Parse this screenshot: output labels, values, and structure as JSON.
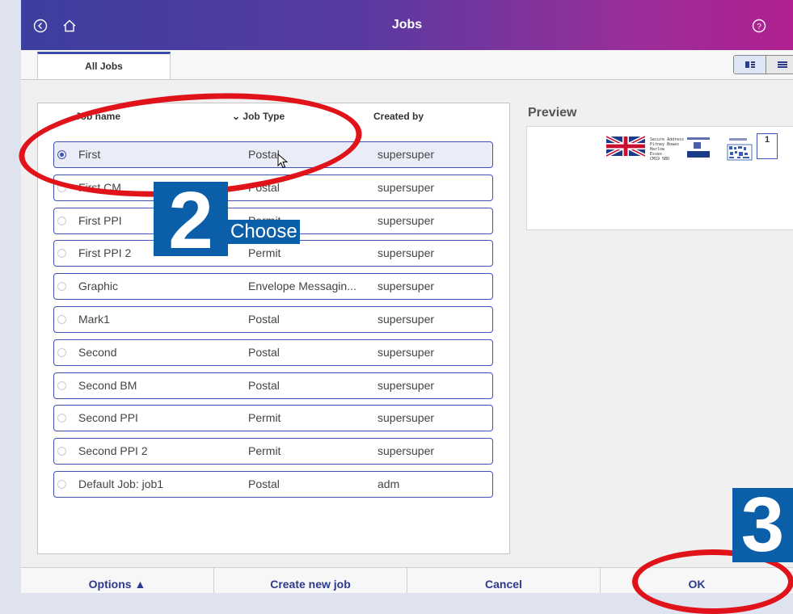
{
  "header": {
    "title": "Jobs",
    "back_icon": "back-circle-icon",
    "home_icon": "home-icon",
    "help_icon": "help-circle-icon"
  },
  "tabs": [
    {
      "label": "All Jobs"
    }
  ],
  "view_toggle": {
    "icons": [
      "grid-view-icon",
      "list-view-icon"
    ]
  },
  "columns": {
    "job_name": "Job name",
    "job_type": "Job Type",
    "created_by": "Created by"
  },
  "jobs": [
    {
      "name": "First",
      "type": "Postal",
      "created_by": "supersuper",
      "selected": true
    },
    {
      "name": "First CM",
      "type": "Postal",
      "created_by": "supersuper"
    },
    {
      "name": "First PPI",
      "type": "Permit",
      "created_by": "supersuper"
    },
    {
      "name": "First PPI 2",
      "type": "Permit",
      "created_by": "supersuper"
    },
    {
      "name": "Graphic",
      "type": "Envelope Messagin...",
      "created_by": "supersuper"
    },
    {
      "name": "Mark1",
      "type": "Postal",
      "created_by": "supersuper"
    },
    {
      "name": "Second",
      "type": "Postal",
      "created_by": "supersuper"
    },
    {
      "name": "Second BM",
      "type": "Postal",
      "created_by": "supersuper"
    },
    {
      "name": "Second PPI",
      "type": "Permit",
      "created_by": "supersuper"
    },
    {
      "name": "Second PPI 2",
      "type": "Permit",
      "created_by": "supersuper"
    },
    {
      "name": "Default Job: job1",
      "type": "Postal",
      "created_by": "adm"
    }
  ],
  "preview": {
    "title": "Preview",
    "address_lines": [
      "Secure Address",
      "Pitney Bowes",
      "Harlow",
      "Essex",
      "CM19 5BD"
    ],
    "stamp_value": "1"
  },
  "footer": {
    "options": "Options ▲",
    "create": "Create new job",
    "cancel": "Cancel",
    "ok": "OK"
  },
  "annotations": {
    "step2_number": "2",
    "step2_label": "Choose",
    "step3_number": "3"
  },
  "colors": {
    "accent": "#3f51b5",
    "callout": "#0b5fa9",
    "highlight_ring": "#e0131b"
  }
}
